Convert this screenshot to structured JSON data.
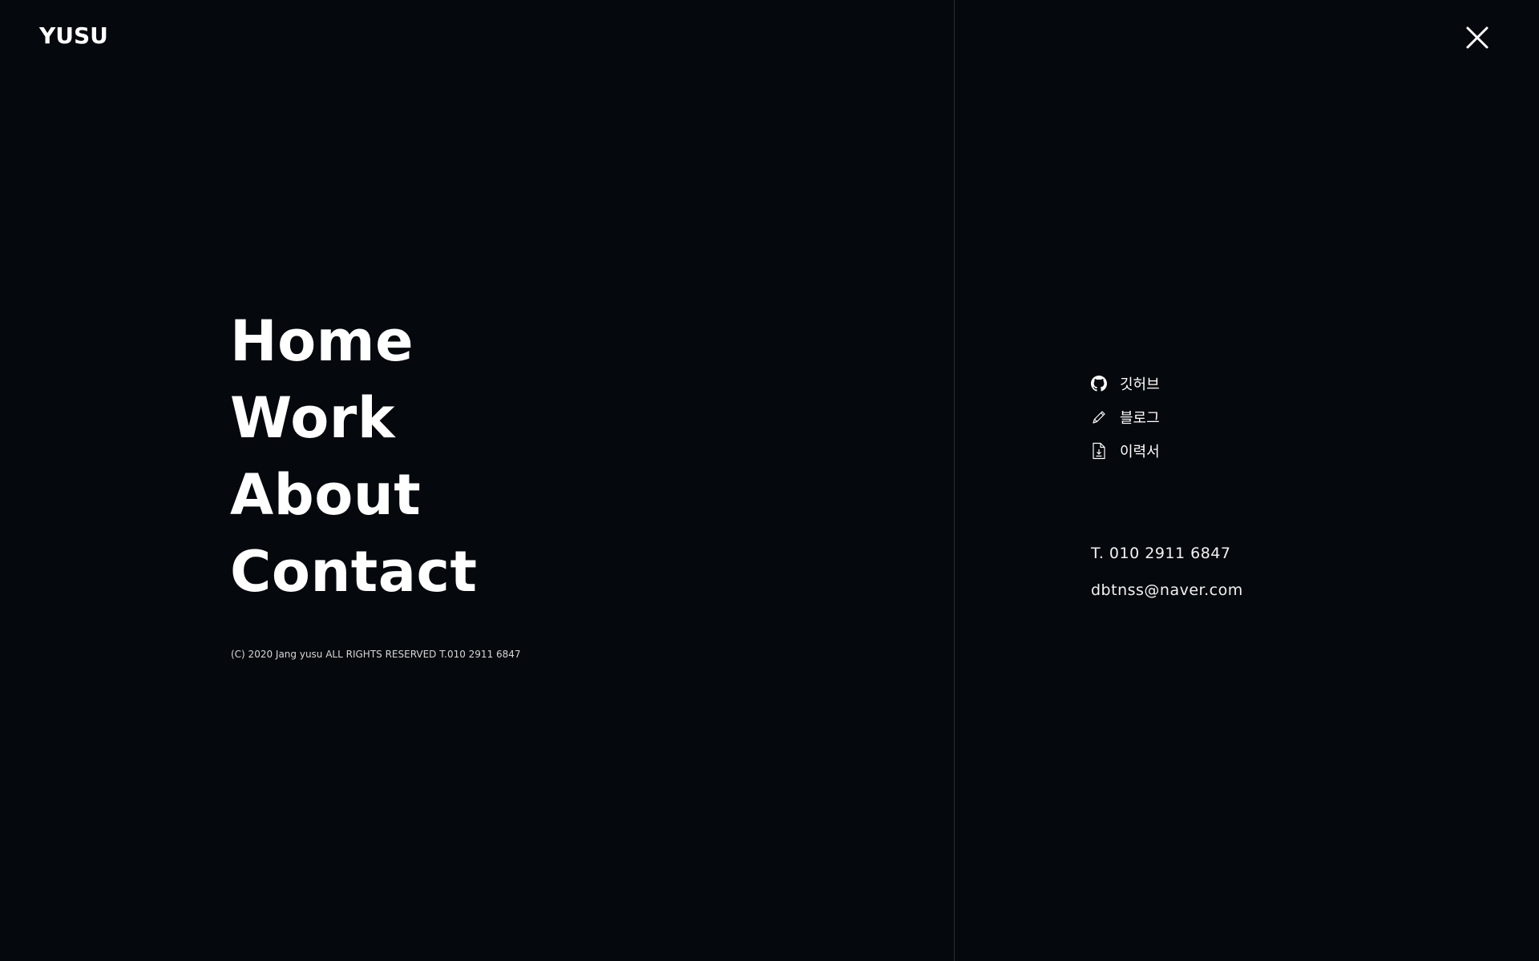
{
  "header": {
    "logo": "YUSU"
  },
  "nav": {
    "items": [
      {
        "label": "Home"
      },
      {
        "label": "Work"
      },
      {
        "label": "About"
      },
      {
        "label": "Contact"
      }
    ]
  },
  "footer": {
    "copyright": "(C) 2020 Jang yusu ALL RIGHTS RESERVED T.010 2911 6847"
  },
  "side_links": {
    "items": [
      {
        "label": "깃허브",
        "icon": "github-icon"
      },
      {
        "label": "블로그",
        "icon": "pencil-icon"
      },
      {
        "label": "이력서",
        "icon": "file-download-icon"
      }
    ]
  },
  "contact": {
    "phone": "T. 010 2911 6847",
    "email": "dbtnss@naver.com"
  },
  "colors": {
    "background": "#05080d",
    "text": "#ffffff",
    "divider": "#2a2d33"
  }
}
